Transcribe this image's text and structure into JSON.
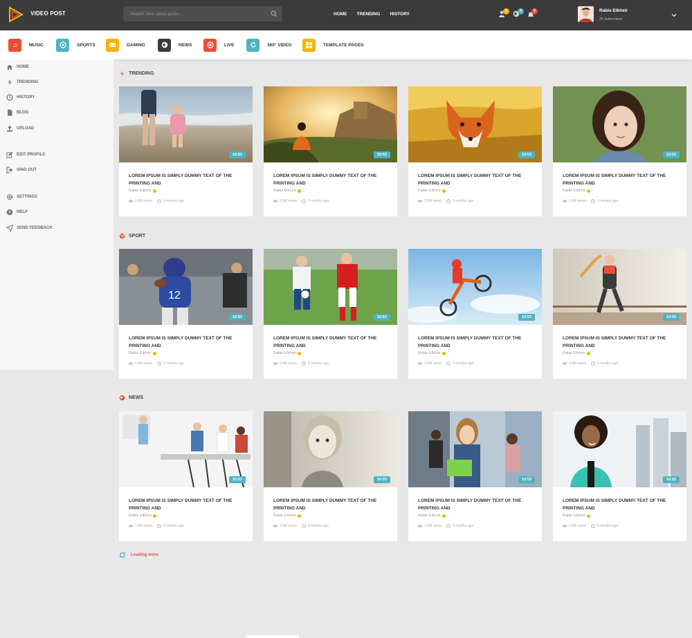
{
  "header": {
    "brand": "VIDEO POST",
    "search_placeholder": "Search here video posts...",
    "nav": [
      "HOME",
      "TRENDING",
      "HISTORY"
    ],
    "badges": [
      {
        "icon": "users-icon",
        "count": "2",
        "color": "#f5b400"
      },
      {
        "icon": "globe-icon",
        "count": "4",
        "color": "#4fb3bf"
      },
      {
        "icon": "bell-icon",
        "count": "9",
        "color": "#e94f37"
      }
    ],
    "user": {
      "name": "Rabie Elkheir",
      "subscribers": "25 Subscribers"
    }
  },
  "categories": [
    {
      "label": "MUSIC",
      "icon": "music-icon",
      "color": "#e94f37"
    },
    {
      "label": "SPORTS",
      "icon": "ball-icon",
      "color": "#4fb3bf"
    },
    {
      "label": "GAMING",
      "icon": "gamepad-icon",
      "color": "#f5b400"
    },
    {
      "label": "NEWS",
      "icon": "globe-icon",
      "color": "#3b3b3b"
    },
    {
      "label": "LIVE",
      "icon": "record-icon",
      "color": "#e94f37"
    },
    {
      "label": "360° VIDEO",
      "icon": "refresh-icon",
      "color": "#4fb3bf"
    },
    {
      "label": "TEMPLATE PAGES",
      "icon": "grid-icon",
      "color": "#f5b400"
    }
  ],
  "sidebar": [
    {
      "label": "HOME",
      "icon": "home-icon"
    },
    {
      "label": "TRENDING",
      "icon": "bolt-icon"
    },
    {
      "label": "HISTORY",
      "icon": "clock-icon"
    },
    {
      "label": "BLOG",
      "icon": "file-icon"
    },
    {
      "label": "UPLOAD",
      "icon": "upload-icon"
    },
    {
      "label": "EDIT PROFILE",
      "icon": "edit-icon"
    },
    {
      "label": "SING OUT",
      "icon": "signout-icon"
    },
    {
      "label": "SETTINGS",
      "icon": "gear-icon"
    },
    {
      "label": "HELP",
      "icon": "help-icon"
    },
    {
      "label": "SEND FEEDBACK",
      "icon": "paper-plane-icon"
    }
  ],
  "sections": [
    {
      "title": "TRENDING",
      "icon": "bolt-icon",
      "color": "#e94f37"
    },
    {
      "title": "SPORT",
      "icon": "ball-icon",
      "color": "#e94f37"
    },
    {
      "title": "NEWS",
      "icon": "globe-icon",
      "color": "#e94f37"
    }
  ],
  "card": {
    "duration": "10:53",
    "title": "LOREM IPSUM IS SIMPLY DUMMY TEXT OF THE PRINTING AND",
    "author": "Rabie Elkheir",
    "views": "2.8M views",
    "age": "5 months ago"
  },
  "loading": "Loading more",
  "colors": {
    "accent": "#e94f37",
    "teal": "#4fb3bf",
    "yellow": "#f5b400",
    "dark": "#3b3b3b"
  }
}
